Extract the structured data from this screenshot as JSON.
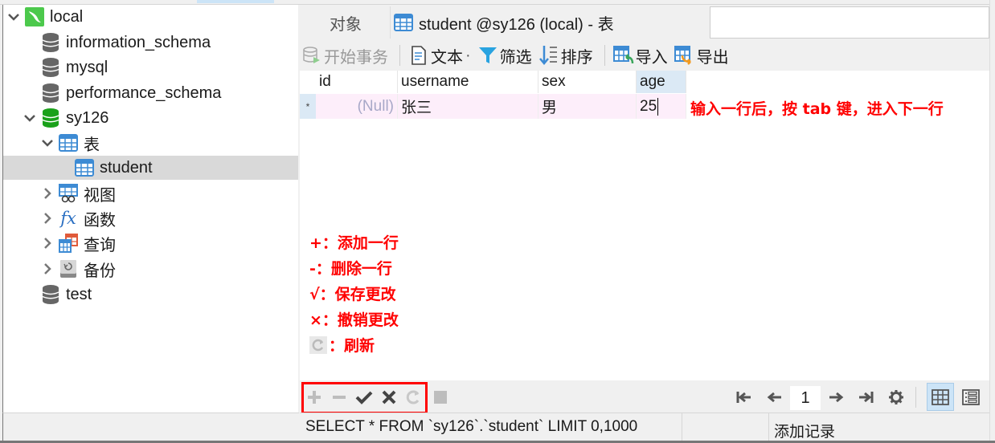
{
  "tree": {
    "connection": "local",
    "databases": [
      "information_schema",
      "mysql",
      "performance_schema"
    ],
    "active_db": "sy126",
    "tables_group": "表",
    "selected_table": "student",
    "groups": [
      "视图",
      "函数",
      "查询",
      "备份"
    ],
    "other_db": "test"
  },
  "tabs": {
    "objects": "对象",
    "active": "student @sy126 (local) - 表"
  },
  "toolbar": {
    "begin_transaction": "开始事务",
    "text": "文本",
    "text_dropdown": "·",
    "filter": "筛选",
    "sort": "排序",
    "import": "导入",
    "export": "导出"
  },
  "grid": {
    "columns": [
      "id",
      "username",
      "sex",
      "age"
    ],
    "rows": [
      {
        "marker": "*",
        "id": "(Null)",
        "username": "张三",
        "sex": "男",
        "age": "25"
      }
    ]
  },
  "annotations": {
    "tab_hint": "输入一行后，按 tab 键，进入下一行",
    "legend": [
      "+：添加一行",
      "-：删除一行",
      "√：保存更改",
      "×：撤销更改",
      "：刷新"
    ]
  },
  "pagination": {
    "current_page": "1"
  },
  "status": {
    "sql": "SELECT * FROM `sy126`.`student` LIMIT 0,1000",
    "action": "添加记录"
  },
  "colors": {
    "annotation": "#ff0000",
    "edit_row_bg": "#fdeefa",
    "active_db_icon": "#1aa11a",
    "selection_bg": "#d9d9d9"
  }
}
